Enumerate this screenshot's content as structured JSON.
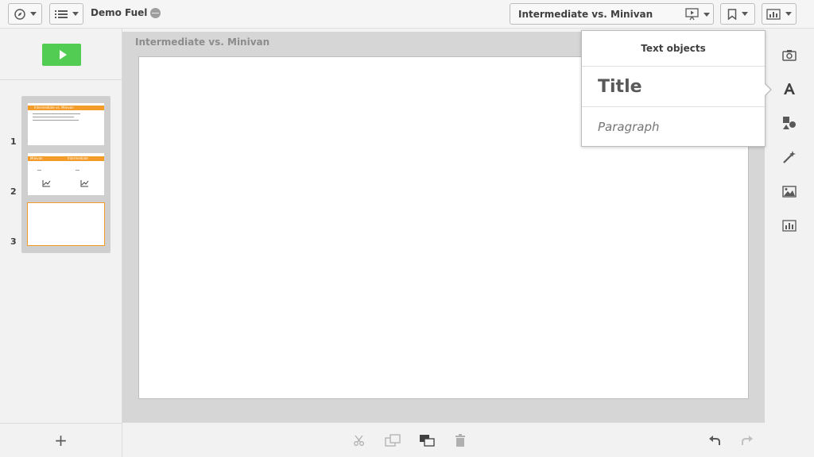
{
  "app": {
    "name": "Demo Fuel"
  },
  "toolbar": {
    "story_title": "Intermediate vs. Minivan",
    "icons": [
      "compass-icon",
      "list-icon",
      "globe-icon",
      "presentation-icon",
      "bookmark-icon",
      "chart-icon"
    ]
  },
  "sidebar": {
    "play_icon": "play-icon",
    "add_label": "+",
    "slides": [
      {
        "number": "1",
        "thumb_title": "Intermediate vs. Minivan",
        "selected": false
      },
      {
        "number": "2",
        "thumb_left": "Minivan",
        "thumb_right": "Intermediate",
        "selected": false
      },
      {
        "number": "3",
        "selected": true
      }
    ]
  },
  "workarea": {
    "slide_title": "Intermediate vs. Minivan"
  },
  "popover": {
    "header": "Text objects",
    "title_item": "Title",
    "paragraph_item": "Paragraph"
  },
  "rightbar": {
    "icons": [
      "camera-icon",
      "text-icon",
      "shapes-icon",
      "magic-wand-icon",
      "image-icon",
      "media-chart-icon"
    ]
  },
  "bottombar": {
    "icons": [
      "cut-icon",
      "duplicate-icon",
      "layer-icon",
      "delete-icon",
      "undo-icon",
      "redo-icon"
    ]
  },
  "colors": {
    "accent": "#f39c2a",
    "play": "#52cc52"
  }
}
